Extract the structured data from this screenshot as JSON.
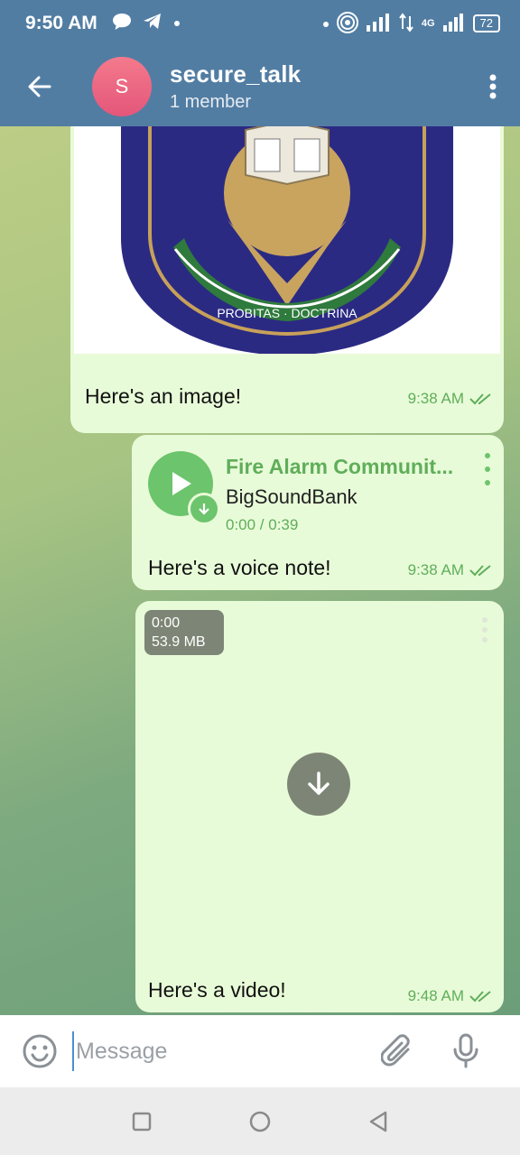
{
  "status_bar": {
    "time": "9:50 AM",
    "network": "4G",
    "battery": "72"
  },
  "header": {
    "avatar_letter": "S",
    "title": "secure_talk",
    "subtitle": "1 member"
  },
  "messages": [
    {
      "kind": "image",
      "text": "Here's an image!",
      "time": "9:38 AM",
      "image_caption_text": "PROBITAS · DOCTRINA"
    },
    {
      "kind": "audio",
      "title": "Fire Alarm Communit...",
      "performer": "BigSoundBank",
      "duration": "0:00 / 0:39",
      "text": "Here's a voice note!",
      "time": "9:38 AM"
    },
    {
      "kind": "video",
      "duration": "0:00",
      "size": "53.9 MB",
      "text": "Here's a video!",
      "time": "9:48 AM"
    }
  ],
  "composer": {
    "placeholder": "Message"
  },
  "colors": {
    "header": "#527da3",
    "bubble": "#e8fbd8",
    "accent_green": "#5fae5a"
  }
}
